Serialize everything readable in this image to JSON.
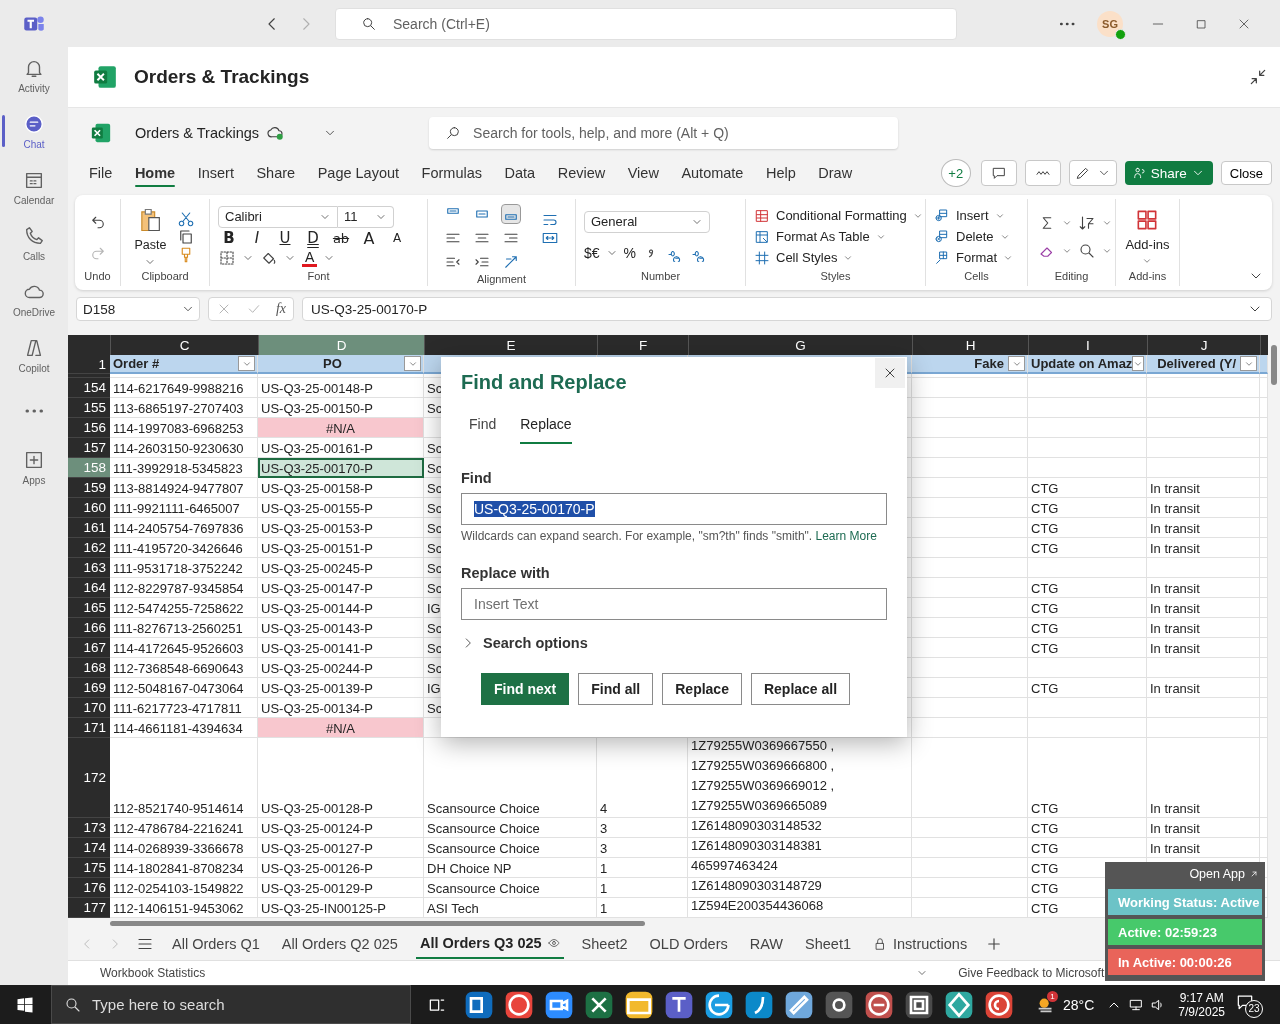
{
  "teams": {
    "search_placeholder": "Search (Ctrl+E)",
    "avatar": "SG",
    "rail": [
      {
        "label": "Activity",
        "selected": false
      },
      {
        "label": "Chat",
        "selected": true
      },
      {
        "label": "Calendar",
        "selected": false
      },
      {
        "label": "Calls",
        "selected": false
      },
      {
        "label": "OneDrive",
        "selected": false
      },
      {
        "label": "Copilot",
        "selected": false
      },
      {
        "selected": false
      },
      {
        "label": "Apps",
        "selected": false
      }
    ]
  },
  "app_header": {
    "title": "Orders & Trackings"
  },
  "file_bar": {
    "name": "Orders & Trackings",
    "search_placeholder": "Search for tools, help, and more (Alt + Q)"
  },
  "menu": [
    {
      "label": "File",
      "selected": false
    },
    {
      "label": "Home",
      "selected": true
    },
    {
      "label": "Insert",
      "selected": false
    },
    {
      "label": "Share",
      "selected": false
    },
    {
      "label": "Page Layout",
      "selected": false
    },
    {
      "label": "Formulas",
      "selected": false
    },
    {
      "label": "Data",
      "selected": false
    },
    {
      "label": "Review",
      "selected": false
    },
    {
      "label": "View",
      "selected": false
    },
    {
      "label": "Automate",
      "selected": false
    },
    {
      "label": "Help",
      "selected": false
    },
    {
      "label": "Draw",
      "selected": false
    }
  ],
  "menu_right": {
    "collaborators": "+2",
    "share": "Share",
    "close": "Close"
  },
  "ribbon": {
    "undo_label": "Undo",
    "clipboard": {
      "paste": "Paste",
      "label": "Clipboard"
    },
    "font": {
      "family": "Calibri",
      "size": "11",
      "styles": [
        {
          "kind": "bold",
          "label": "B"
        },
        {
          "kind": "italic",
          "label": "I"
        },
        {
          "kind": "underline",
          "label": "U"
        },
        {
          "kind": "double",
          "label": "D"
        },
        {
          "kind": "strike",
          "label": "ab"
        },
        {
          "kind": "grow",
          "label": "A"
        },
        {
          "kind": "shrink",
          "label": "A"
        }
      ],
      "color_button": "A",
      "label": "Font"
    },
    "alignment": {
      "label": "Alignment"
    },
    "number": {
      "format": "General",
      "currency": "$€",
      "percent": "%",
      "label": "Number"
    },
    "styles": {
      "items": [
        "Conditional Formatting",
        "Format As Table",
        "Cell Styles"
      ],
      "label": "Styles"
    },
    "cells": {
      "items": [
        "Insert",
        "Delete",
        "Format"
      ],
      "label": "Cells"
    },
    "editing": {
      "label": "Editing"
    },
    "addins": {
      "button": "Add-ins",
      "label": "Add-ins"
    }
  },
  "formula_bar": {
    "name_box": "D158",
    "fx": "fx",
    "value": "US-Q3-25-00170-P"
  },
  "sheet": {
    "columns": [
      {
        "letter": "C",
        "selected": false
      },
      {
        "letter": "D",
        "selected": true
      },
      {
        "letter": "E",
        "selected": false
      },
      {
        "letter": "F",
        "selected": false
      },
      {
        "letter": "G",
        "selected": false
      },
      {
        "letter": "H",
        "selected": false
      },
      {
        "letter": "I",
        "selected": false
      },
      {
        "letter": "J",
        "selected": false
      }
    ],
    "header_row": {
      "number": "1",
      "order": "Order #",
      "po": "PO",
      "fake": "Fake",
      "update": "Update on Amaz",
      "delivered": "Delivered (Y/"
    },
    "rows": [
      {
        "number": "154",
        "selected": false,
        "order": "114-6217649-9988216",
        "po": "US-Q3-25-00148-P",
        "po_error": false,
        "supplier": "Sc"
      },
      {
        "number": "155",
        "selected": false,
        "order": "113-6865197-2707403",
        "po": "US-Q3-25-00150-P",
        "po_error": false,
        "supplier": "Sc"
      },
      {
        "number": "156",
        "selected": false,
        "order": "114-1997083-6968253",
        "po": "#N/A",
        "po_error": true
      },
      {
        "number": "157",
        "selected": false,
        "order": "114-2603150-9230630",
        "po": "US-Q3-25-00161-P",
        "po_error": false,
        "supplier": "Sc"
      },
      {
        "number": "158",
        "selected": true,
        "order": "111-3992918-5345823",
        "po": "US-Q3-25-00170-P",
        "po_error": false,
        "supplier": "Sc"
      },
      {
        "number": "159",
        "selected": false,
        "order": "113-8814924-9477807",
        "po": "US-Q3-25-00158-P",
        "po_error": false,
        "supplier": "Sc",
        "update": "CTG",
        "delivered": "In transit"
      },
      {
        "number": "160",
        "selected": false,
        "order": "111-9921111-6465007",
        "po": "US-Q3-25-00155-P",
        "po_error": false,
        "supplier": "Sc",
        "update": "CTG",
        "delivered": "In transit"
      },
      {
        "number": "161",
        "selected": false,
        "order": "114-2405754-7697836",
        "po": "US-Q3-25-00153-P",
        "po_error": false,
        "supplier": "Sc",
        "update": "CTG",
        "delivered": "In transit"
      },
      {
        "number": "162",
        "selected": false,
        "order": "111-4195720-3426646",
        "po": "US-Q3-25-00151-P",
        "po_error": false,
        "supplier": "Sc",
        "update": "CTG",
        "delivered": "In transit"
      },
      {
        "number": "163",
        "selected": false,
        "order": "111-9531718-3752242",
        "po": "US-Q3-25-00245-P",
        "po_error": false,
        "supplier": "Sc"
      },
      {
        "number": "164",
        "selected": false,
        "order": "112-8229787-9345854",
        "po": "US-Q3-25-00147-P",
        "po_error": false,
        "supplier": "Sc",
        "update": "CTG",
        "delivered": "In transit"
      },
      {
        "number": "165",
        "selected": false,
        "order": "112-5474255-7258622",
        "po": "US-Q3-25-00144-P",
        "po_error": false,
        "supplier": "IG",
        "update": "CTG",
        "delivered": "In transit"
      },
      {
        "number": "166",
        "selected": false,
        "order": "111-8276713-2560251",
        "po": "US-Q3-25-00143-P",
        "po_error": false,
        "supplier": "Sc",
        "update": "CTG",
        "delivered": "In transit"
      },
      {
        "number": "167",
        "selected": false,
        "order": "114-4172645-9526603",
        "po": "US-Q3-25-00141-P",
        "po_error": false,
        "supplier": "Sc",
        "update": "CTG",
        "delivered": "In transit"
      },
      {
        "number": "168",
        "selected": false,
        "order": "112-7368548-6690643",
        "po": "US-Q3-25-00244-P",
        "po_error": false,
        "supplier": "Sc"
      },
      {
        "number": "169",
        "selected": false,
        "order": "112-5048167-0473064",
        "po": "US-Q3-25-00139-P",
        "po_error": false,
        "supplier": "IG",
        "update": "CTG",
        "delivered": "In transit"
      },
      {
        "number": "170",
        "selected": false,
        "order": "111-6217723-4717811",
        "po": "US-Q3-25-00134-P",
        "po_error": false,
        "supplier": "Sc"
      },
      {
        "number": "171",
        "selected": false,
        "order": "114-4661181-4394634",
        "po": "#N/A",
        "po_error": true
      },
      {
        "number": "172",
        "selected": false,
        "order": "112-8521740-9514614",
        "po": "US-Q3-25-00128-P",
        "po_error": false,
        "supplier": "Scansource Choice",
        "qty": "4",
        "tracking": [
          "1Z79255W0369667550 ,",
          "1Z79255W0369666800 ,",
          "1Z79255W0369669012 ,",
          "1Z79255W0369665089"
        ],
        "update": "CTG",
        "delivered": "In transit"
      },
      {
        "number": "173",
        "selected": false,
        "order": "112-4786784-2216241",
        "po": "US-Q3-25-00124-P",
        "po_error": false,
        "supplier": "Scansource Choice",
        "qty": "3",
        "tracking": [
          "1Z6148090303148532"
        ],
        "update": "CTG",
        "delivered": "In transit"
      },
      {
        "number": "174",
        "selected": false,
        "order": "114-0268939-3366678",
        "po": "US-Q3-25-00127-P",
        "po_error": false,
        "supplier": "Scansource Choice",
        "qty": "3",
        "tracking": [
          "1Z6148090303148381"
        ],
        "update": "CTG",
        "delivered": "In transit"
      },
      {
        "number": "175",
        "selected": false,
        "order": "114-1802841-8708234",
        "po": "US-Q3-25-00126-P",
        "po_error": false,
        "supplier": "DH Choice NP",
        "qty": "1",
        "tracking": [
          "465997463424"
        ],
        "update": "CTG"
      },
      {
        "number": "176",
        "selected": false,
        "order": "112-0254103-1549822",
        "po": "US-Q3-25-00129-P",
        "po_error": false,
        "supplier": "Scansource Choice",
        "qty": "1",
        "tracking": [
          "1Z6148090303148729"
        ],
        "update": "CTG"
      },
      {
        "number": "177",
        "selected": false,
        "order": "112-1406151-9453062",
        "po": "US-Q3-25-IN00125-P",
        "po_error": false,
        "supplier": "ASI Tech",
        "qty": "1",
        "tracking": [
          "1Z594E200354436068"
        ],
        "update": "CTG"
      }
    ]
  },
  "dialog": {
    "title": "Find and Replace",
    "tabs": [
      {
        "label": "Find",
        "selected": false
      },
      {
        "label": "Replace",
        "selected": true
      }
    ],
    "find_label": "Find",
    "find_value": "US-Q3-25-00170-P",
    "find_value_selected": true,
    "hint": "Wildcards can expand search. For example, \"sm?th\" finds \"smith\".",
    "learn_more": "Learn More",
    "replace_label": "Replace with",
    "replace_placeholder": "Insert Text",
    "search_options": "Search options",
    "buttons": [
      {
        "label": "Find next",
        "kind": "primary"
      },
      {
        "label": "Find all",
        "kind": "secondary"
      },
      {
        "label": "Replace",
        "kind": "secondary"
      },
      {
        "label": "Replace all",
        "kind": "secondary"
      }
    ]
  },
  "sheet_tabs": [
    {
      "label": "All Orders Q1",
      "selected": false,
      "kind": "plain"
    },
    {
      "label": "All Orders Q2 025",
      "selected": false,
      "kind": "plain"
    },
    {
      "label": "All Orders Q3 025",
      "selected": true,
      "kind": "watched"
    },
    {
      "label": "Sheet2",
      "selected": false,
      "kind": "plain"
    },
    {
      "label": "OLD Orders",
      "selected": false,
      "kind": "plain"
    },
    {
      "label": "RAW",
      "selected": false,
      "kind": "plain"
    },
    {
      "label": "Sheet1",
      "selected": false,
      "kind": "plain"
    },
    {
      "label": "Instructions",
      "selected": false,
      "kind": "locked"
    }
  ],
  "status_bar": {
    "statistics": "Workbook Statistics",
    "feedback": "Give Feedback to Microsoft"
  },
  "tracker": {
    "open_app": "Open App",
    "status": "Working Status: Active",
    "active": "Active: 02:59:23",
    "inactive": "In Active: 00:00:26"
  },
  "taskbar": {
    "search_placeholder": "Type here to search",
    "weather_badge": "1",
    "temperature": "28°C",
    "time": "9:17 AM",
    "date": "7/9/2025",
    "notifications": "23"
  }
}
